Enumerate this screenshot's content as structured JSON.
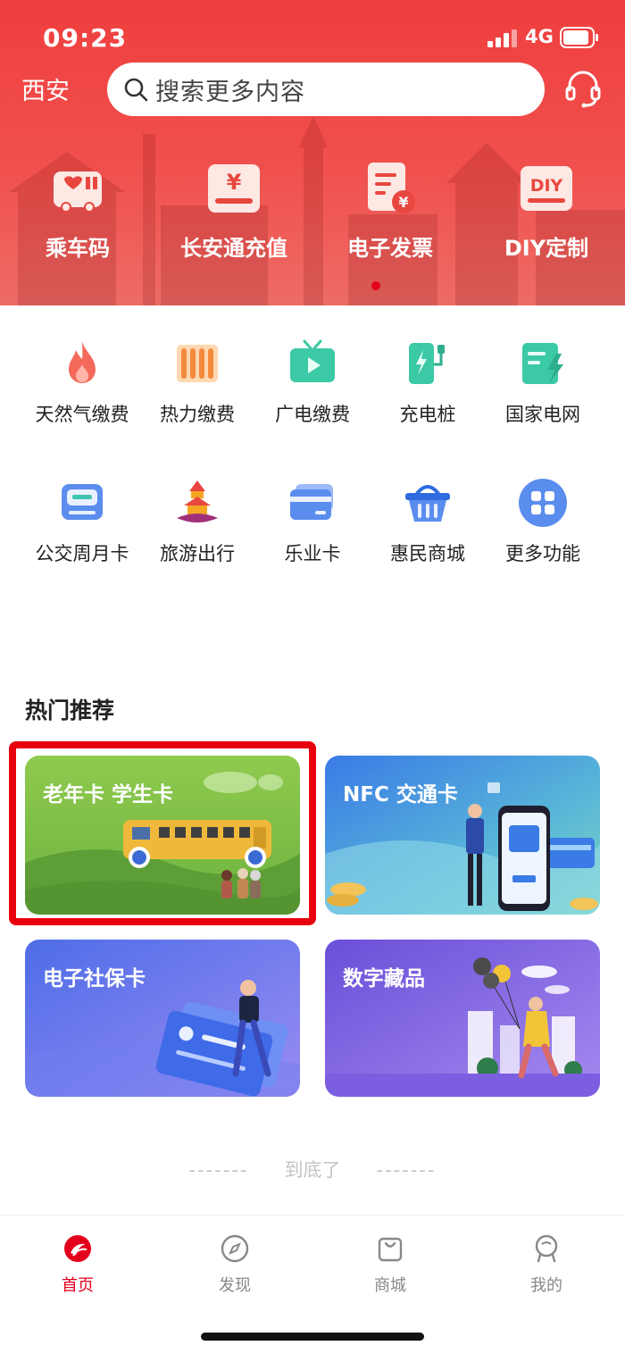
{
  "status_bar": {
    "time": "09:23",
    "network": "4G"
  },
  "header": {
    "city": "西安",
    "search_placeholder": "搜索更多内容",
    "quick_actions": [
      {
        "label": "乘车码",
        "icon": "bus-qr-icon"
      },
      {
        "label": "长安通充值",
        "icon": "yuan-card-icon"
      },
      {
        "label": "电子发票",
        "icon": "invoice-icon"
      },
      {
        "label": "DIY定制",
        "icon": "diy-icon"
      }
    ]
  },
  "services": [
    {
      "label": "天然气缴费",
      "icon": "flame-icon"
    },
    {
      "label": "热力缴费",
      "icon": "radiator-icon"
    },
    {
      "label": "广电缴费",
      "icon": "tv-icon"
    },
    {
      "label": "充电桩",
      "icon": "charging-pile-icon"
    },
    {
      "label": "国家电网",
      "icon": "power-grid-icon"
    },
    {
      "label": "公交周月卡",
      "icon": "bus-card-icon"
    },
    {
      "label": "旅游出行",
      "icon": "pagoda-icon"
    },
    {
      "label": "乐业卡",
      "icon": "credit-card-icon"
    },
    {
      "label": "惠民商城",
      "icon": "shopping-basket-icon"
    },
    {
      "label": "更多功能",
      "icon": "grid-more-icon"
    }
  ],
  "recommend": {
    "title": "热门推荐",
    "cards": [
      {
        "title": "老年卡 学生卡"
      },
      {
        "title": "NFC 交通卡"
      },
      {
        "title": "电子社保卡"
      },
      {
        "title": "数字藏品"
      }
    ]
  },
  "end_text": "到底了",
  "end_dashes": "-------",
  "tabbar": [
    {
      "label": "首页",
      "active": true
    },
    {
      "label": "发现",
      "active": false
    },
    {
      "label": "商城",
      "active": false
    },
    {
      "label": "我的",
      "active": false
    }
  ],
  "colors": {
    "brand_red": "#e4001c",
    "header_red": "#ef3e3e",
    "inactive_gray": "#888888"
  }
}
